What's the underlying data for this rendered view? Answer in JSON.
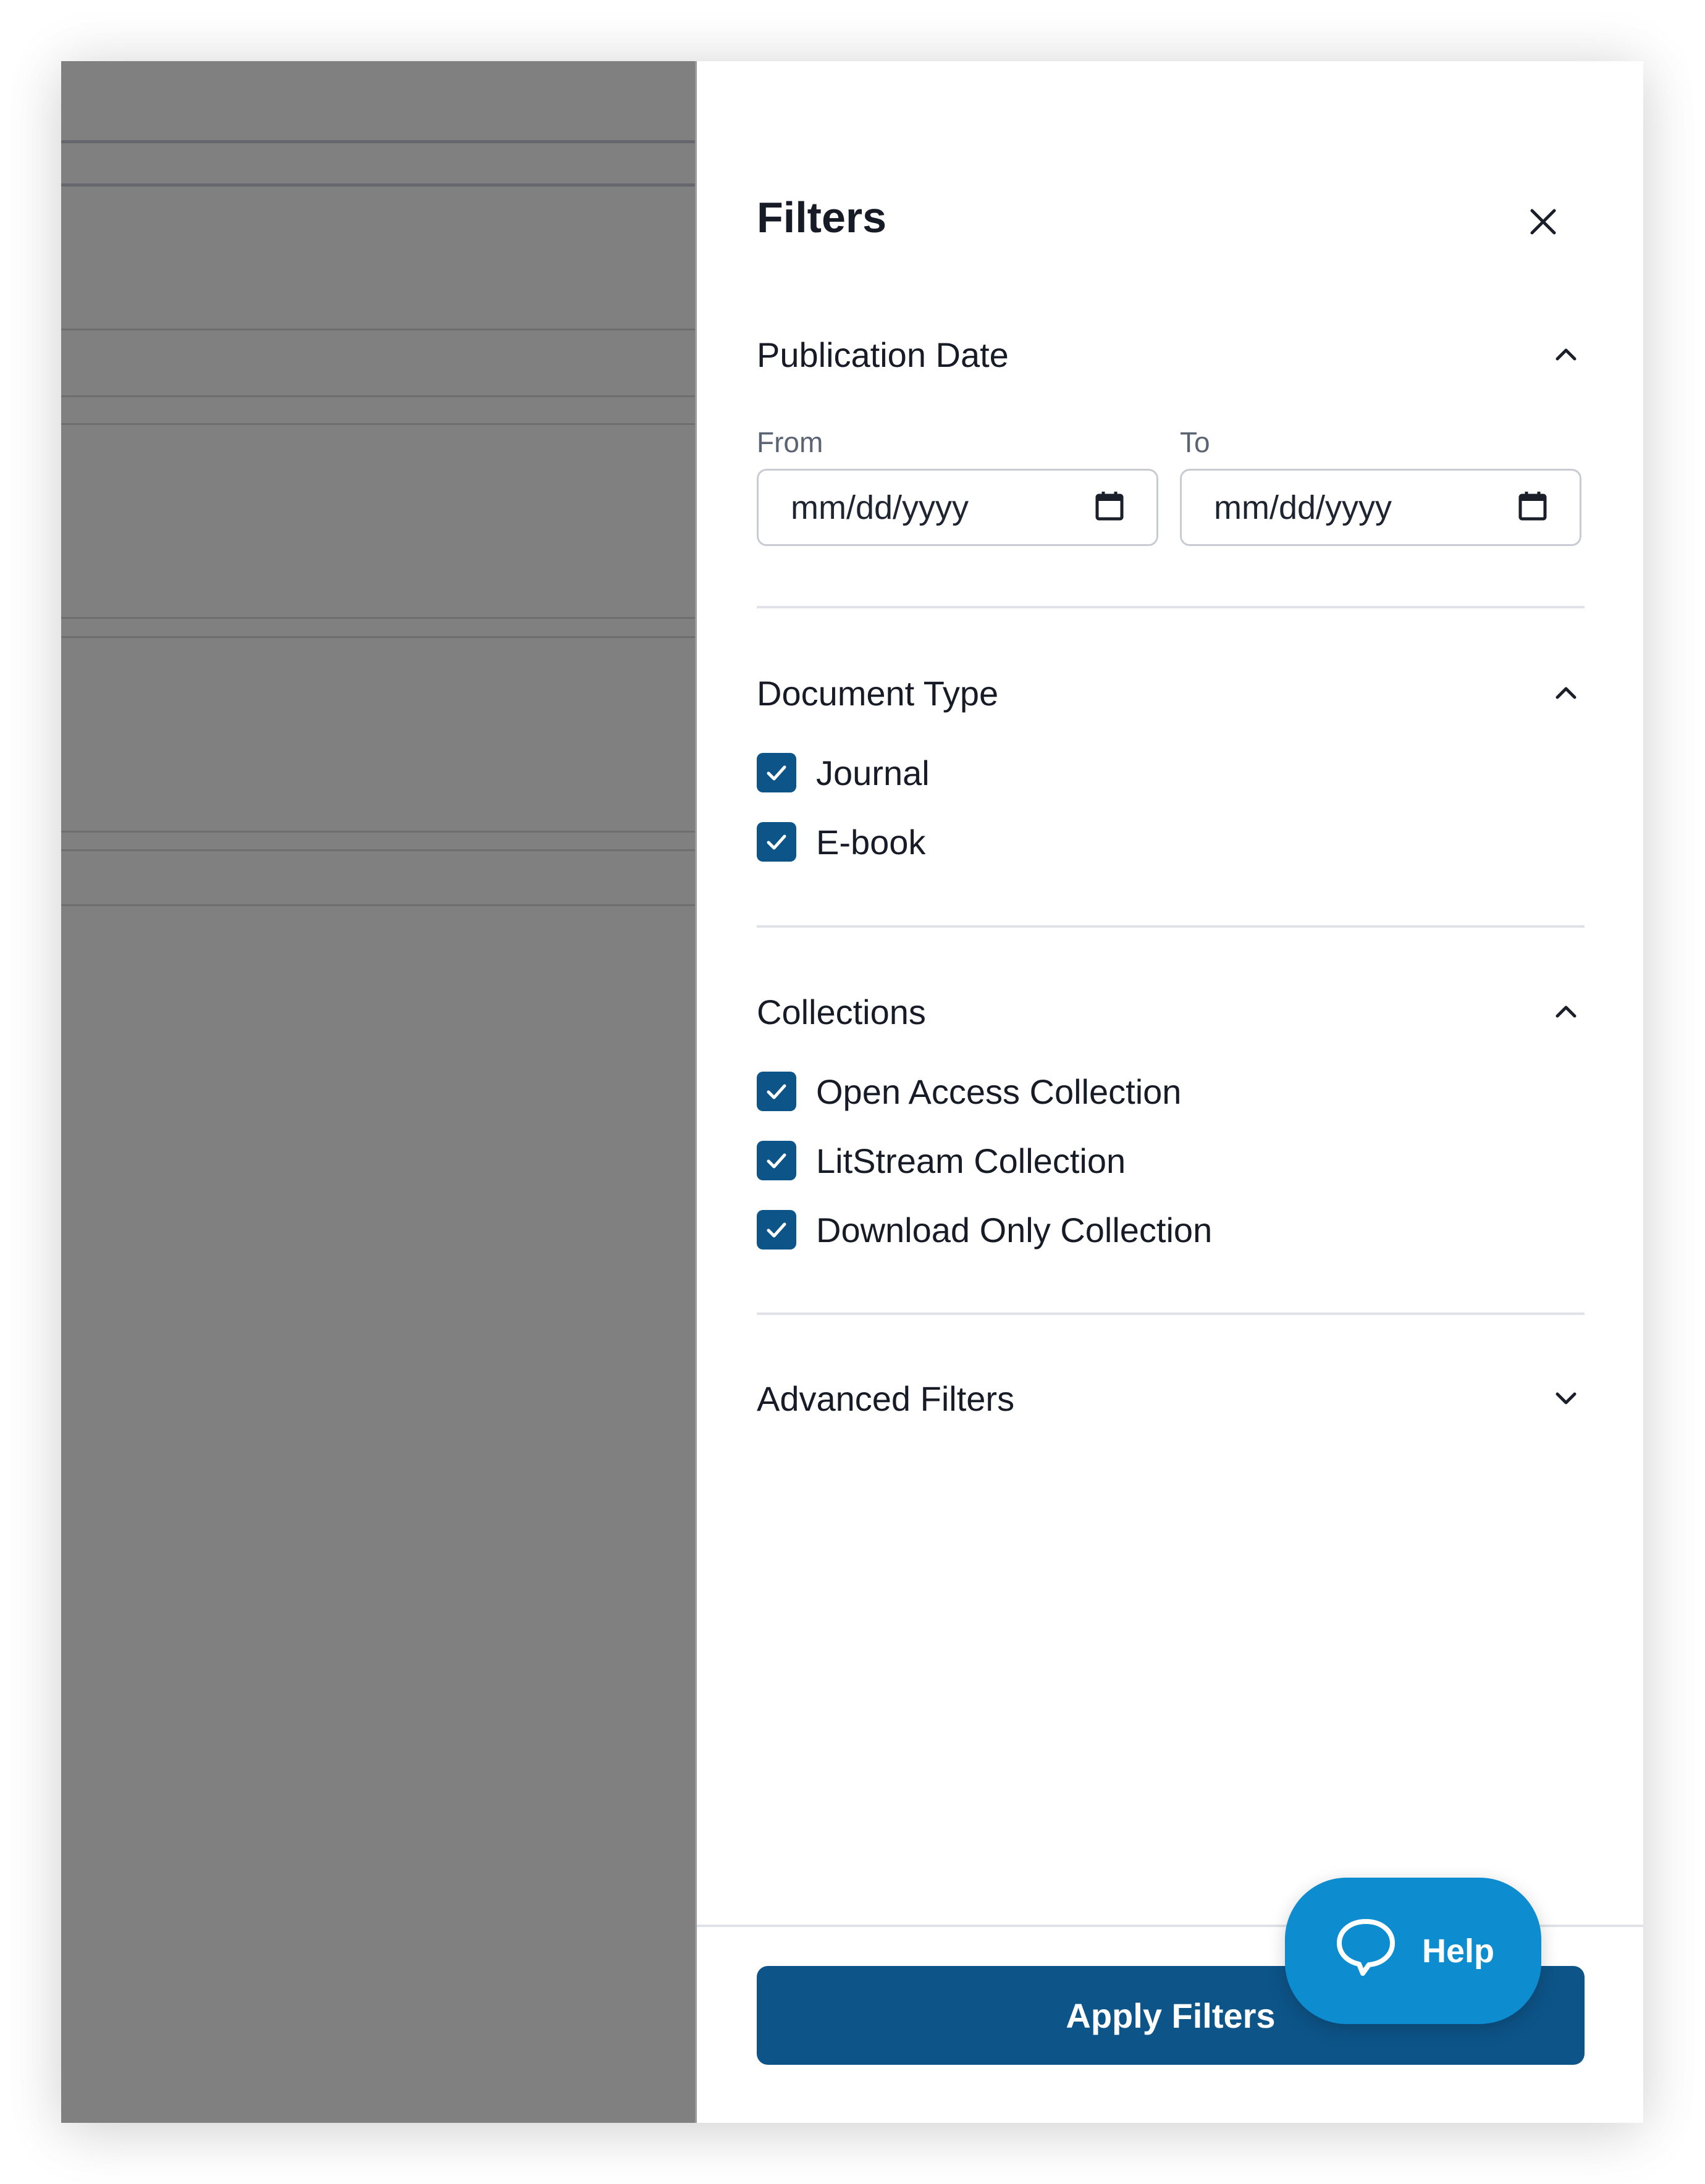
{
  "panel": {
    "title": "Filters"
  },
  "icons": {
    "close": "close-icon",
    "expand": "chevron-up-icon",
    "collapse": "chevron-down-icon",
    "calendar": "calendar-icon",
    "check": "check-icon",
    "help": "chat-bubble-icon"
  },
  "publication_date": {
    "label": "Publication Date",
    "expanded": true,
    "from_label": "From",
    "to_label": "To",
    "from_placeholder": "mm/dd/yyyy",
    "to_placeholder": "mm/dd/yyyy"
  },
  "document_type": {
    "label": "Document Type",
    "expanded": true,
    "options": [
      {
        "label": "Journal",
        "checked": true
      },
      {
        "label": "E-book",
        "checked": true
      }
    ]
  },
  "collections": {
    "label": "Collections",
    "expanded": true,
    "options": [
      {
        "label": "Open Access Collection",
        "checked": true
      },
      {
        "label": "LitStream Collection",
        "checked": true
      },
      {
        "label": "Download Only Collection",
        "checked": true
      }
    ]
  },
  "advanced_filters": {
    "label": "Advanced Filters",
    "expanded": false
  },
  "footer": {
    "apply_label": "Apply Filters"
  },
  "help_widget": {
    "label": "Help"
  },
  "colors": {
    "primary": "#0d5488",
    "help_button": "#0d8ccf",
    "overlay": "#808080"
  }
}
